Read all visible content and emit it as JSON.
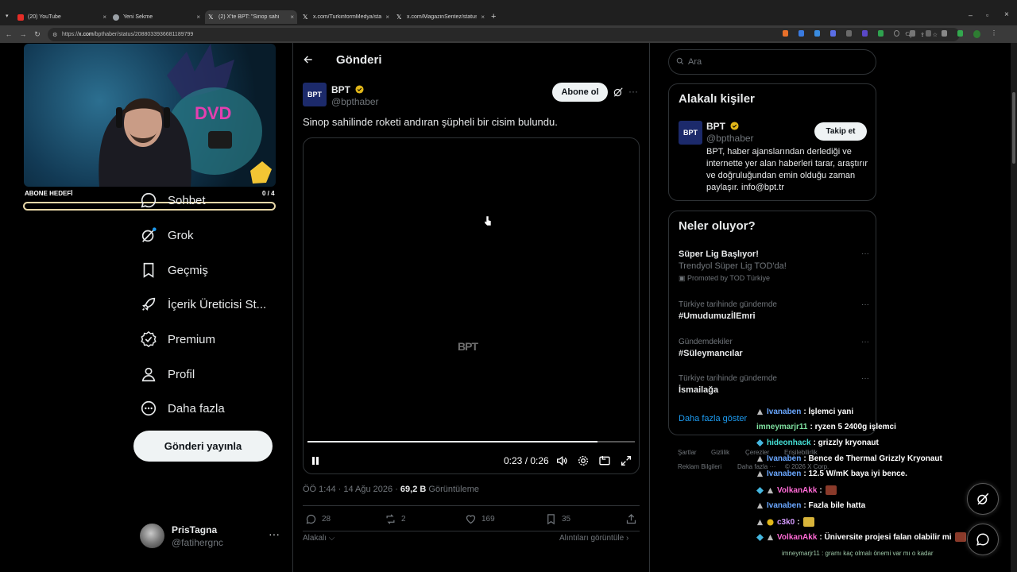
{
  "browser": {
    "tabs": [
      {
        "title": "(20) YouTube",
        "favicon": "youtube-icon"
      },
      {
        "title": "Yeni Sekme",
        "favicon": "chrome-icon"
      },
      {
        "title": "(2) X'te BPT: \"Sinop sahilinde",
        "favicon": "x-icon"
      },
      {
        "title": "x.com/TurkinformMedya/status",
        "favicon": "x-icon"
      },
      {
        "title": "x.com/MagazinSentez/status/2",
        "favicon": "x-icon"
      }
    ],
    "url_host": "x.com",
    "url_prefix": "https://",
    "url_path": "/bpthaber/status/2088033936681189799"
  },
  "stream": {
    "goal_label": "ABONE HEDEFİ",
    "goal_count": "0 / 4",
    "goal_progress": 0
  },
  "nav": {
    "items": [
      {
        "label": "Sohbet",
        "icon": "chat-icon"
      },
      {
        "label": "Grok",
        "icon": "grok-icon"
      },
      {
        "label": "Geçmiş",
        "icon": "bookmark-icon"
      },
      {
        "label": "İçerik Üreticisi St...",
        "icon": "rocket-icon"
      },
      {
        "label": "Premium",
        "icon": "verified-icon"
      },
      {
        "label": "Profil",
        "icon": "person-icon"
      },
      {
        "label": "Daha fazla",
        "icon": "more-circle-icon"
      }
    ],
    "post_button": "Gönderi yayınla",
    "account": {
      "name": "PrisTagna",
      "handle": "@fatihergnc"
    }
  },
  "post": {
    "page_title": "Gönderi",
    "author_name": "BPT",
    "author_handle": "@bpthaber",
    "avatar_text": "BPT",
    "subscribe_label": "Abone ol",
    "text": "Sinop sahilinde roketi andıran şüpheli bir cisim bulundu.",
    "video": {
      "watermark": "BPT",
      "time": "0:23 / 0:26",
      "progress": 0.885
    },
    "meta_time": "ÖÖ 1:44 · 14 Ağu 2026 · ",
    "views_count": "69,2 B",
    "views_label": " Görüntüleme",
    "replies": "28",
    "reposts": "2",
    "likes": "169",
    "bookmarks": "35",
    "related_label": "Alakalı",
    "quotes_label": "Alıntıları görüntüle"
  },
  "sidebar": {
    "search_placeholder": "Ara",
    "related": {
      "title": "Alakalı kişiler",
      "name": "BPT",
      "handle": "@bpthaber",
      "follow_label": "Takip et",
      "bio": "BPT, haber ajanslarından derlediği ve internette yer alan haberleri tarar, araştırır ve doğruluğundan emin olduğu zaman paylaşır. info@bpt.tr"
    },
    "trending": {
      "title": "Neler oluyor?",
      "items": [
        {
          "context": "",
          "topic": "Süper Lig Başlıyor!",
          "sub": "Trendyol Süper Lig TOD'da!",
          "promo": "Promoted by TOD Türkiye"
        },
        {
          "context": "Türkiye tarihinde gündemde",
          "topic": "#UmudumuzİlEmri"
        },
        {
          "context": "Gündemdekiler",
          "topic": "#Süleymancılar"
        },
        {
          "context": "Türkiye tarihinde gündemde",
          "topic": "İsmailağa"
        }
      ],
      "show_more": "Daha fazla göster"
    },
    "footer": [
      "Şartlar",
      "Gizlilik",
      "Çerezler",
      "Erişilebilirlik",
      "Reklam Bilgileri",
      "Daha fazla ···",
      "© 2026 X Corp."
    ]
  },
  "chat": {
    "messages": [
      {
        "user": "Ivanaben",
        "text": ": İşlemci yani",
        "color": "#6aa7ff"
      },
      {
        "user": "imneymarjr11",
        "text": ": ryzen 5 2400g işlemci",
        "color": "#7fe0a0"
      },
      {
        "user": "hideonhack",
        "text": ": grizzly kryonaut",
        "color": "#45e0d6"
      },
      {
        "user": "Ivanaben",
        "text": ": Bence de Thermal Grizzly Kryonaut",
        "color": "#6aa7ff"
      },
      {
        "user": "Ivanaben",
        "text": ": 12.5 W/mK baya iyi bence.",
        "color": "#6aa7ff"
      },
      {
        "user": "VolkanAkk",
        "text": ":",
        "color": "#ff6ad5"
      },
      {
        "user": "Ivanaben",
        "text": ": Fazla bile hatta",
        "color": "#6aa7ff"
      },
      {
        "user": "c3k0",
        "text": ":",
        "color": "#d59bff"
      },
      {
        "user": "VolkanAkk",
        "text": ": Üniversite projesi falan olabilir mi",
        "color": "#ff6ad5"
      }
    ],
    "fading": "imneymarjr11 : gramı kaç olmalı önemi var mı o kadar"
  },
  "colors": {
    "accent": "#1d9bf0",
    "verified_gold": "#e2b719",
    "background": "#000000",
    "border": "#2f3336"
  }
}
